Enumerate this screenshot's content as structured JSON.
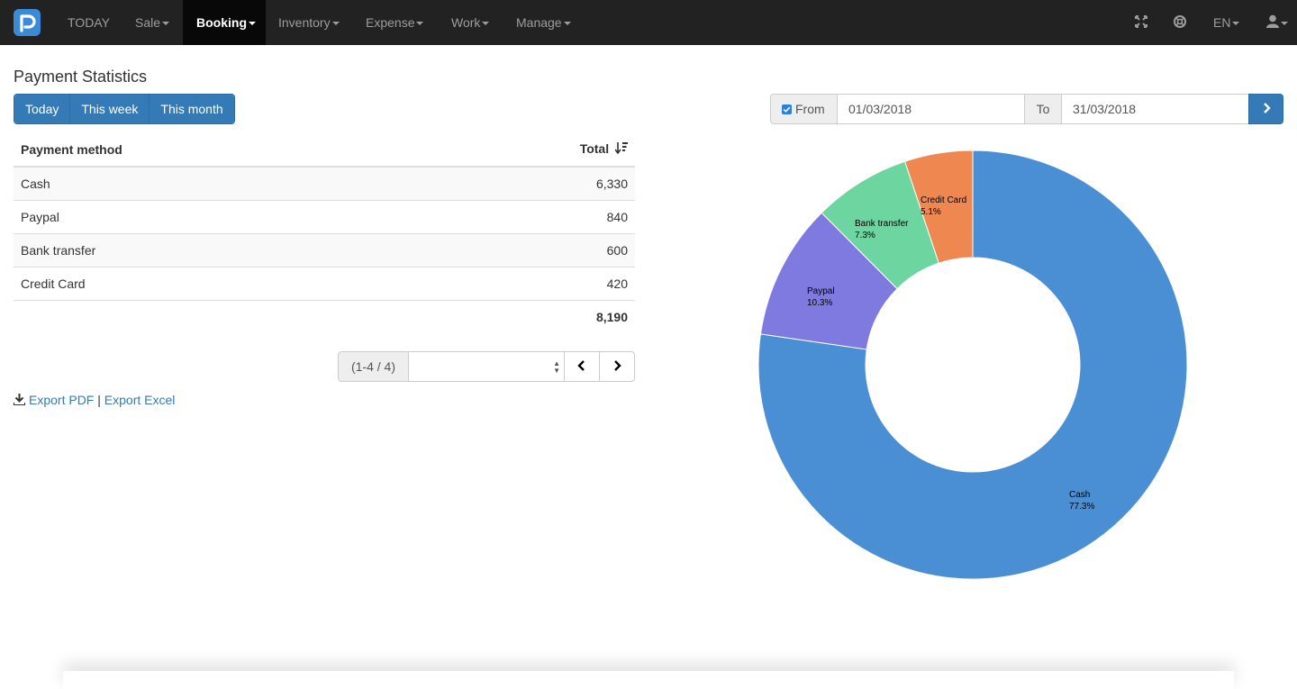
{
  "nav": {
    "items": [
      {
        "label": "TODAY",
        "caret": false,
        "active": false
      },
      {
        "label": "Sale",
        "caret": true,
        "active": false
      },
      {
        "label": "Booking",
        "caret": true,
        "active": true
      },
      {
        "label": "Inventory",
        "caret": true,
        "active": false
      },
      {
        "label": "Expense",
        "caret": true,
        "active": false
      },
      {
        "label": "Work",
        "caret": true,
        "active": false
      },
      {
        "label": "Manage",
        "caret": true,
        "active": false
      }
    ],
    "language": "EN",
    "icons": [
      "fullscreen-icon",
      "support-icon",
      "user-icon"
    ]
  },
  "page": {
    "title": "Payment Statistics"
  },
  "period_buttons": [
    "Today",
    "This week",
    "This month"
  ],
  "table": {
    "col_method": "Payment method",
    "col_total": "Total",
    "rows": [
      {
        "method": "Cash",
        "total": "6,330"
      },
      {
        "method": "Paypal",
        "total": "840"
      },
      {
        "method": "Bank transfer",
        "total": "600"
      },
      {
        "method": "Credit Card",
        "total": "420"
      }
    ],
    "grand_total": "8,190"
  },
  "pager": {
    "range": "(1-4 / 4)",
    "select_value": ""
  },
  "export": {
    "pdf": "Export PDF",
    "separator": "|",
    "excel": "Export Excel"
  },
  "date_filter": {
    "from_label": "From",
    "from_checked": true,
    "from_value": "01/03/2018",
    "to_label": "To",
    "to_value": "31/03/2018"
  },
  "colors": {
    "primary": "#337ab7",
    "navbar": "#222222"
  },
  "chart_data": {
    "type": "pie",
    "donut": true,
    "categories": [
      "Cash",
      "Paypal",
      "Bank transfer",
      "Credit Card"
    ],
    "values": [
      6330,
      840,
      600,
      420
    ],
    "percent_labels": [
      "77.3%",
      "10.3%",
      "7.3%",
      "5.1%"
    ],
    "colors": [
      "#4a8fd3",
      "#7e7ae0",
      "#6dd5a0",
      "#ee8850"
    ]
  }
}
